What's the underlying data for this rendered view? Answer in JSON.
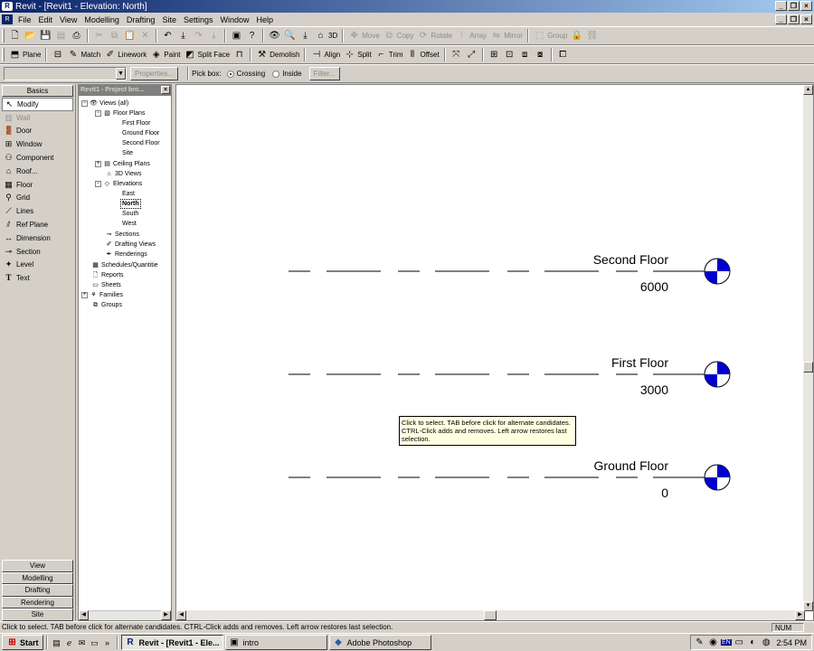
{
  "window": {
    "title": "Revit - [Revit1 - Elevation: North]",
    "app_icon": "revit-logo-icon"
  },
  "menu": [
    "File",
    "Edit",
    "View",
    "Modelling",
    "Drafting",
    "Site",
    "Settings",
    "Window",
    "Help"
  ],
  "toolbar1": {
    "edit_tools": [
      "Move",
      "Copy",
      "Rotate",
      "Array",
      "Mirror",
      "Group"
    ],
    "view_3d_label": "3D"
  },
  "toolbar2": [
    "Plane",
    "Match",
    "Linework",
    "Paint",
    "Split Face",
    "Demolish",
    "Align",
    "Split",
    "Trim",
    "Offset"
  ],
  "options_bar": {
    "properties_label": "Properties...",
    "pick_box_label": "Pick box:",
    "crossing_label": "Crossing",
    "inside_label": "Inside",
    "filter_label": "Filter...",
    "selected": "Crossing"
  },
  "design_bar": {
    "active_tab": "Basics",
    "tools": [
      "Modify",
      "Wall",
      "Door",
      "Window",
      "Component",
      "Roof...",
      "Floor",
      "Grid",
      "Lines",
      "Ref Plane",
      "Dimension",
      "Section",
      "Level",
      "Text"
    ],
    "active_tool": "Modify",
    "disabled_tool": "Wall",
    "bottom_tabs": [
      "View",
      "Modelling",
      "Drafting",
      "Rendering",
      "Site"
    ]
  },
  "project_browser": {
    "title": "Revit1 - Project bro...",
    "root": "Views (all)",
    "floor_plans": "Floor Plans",
    "floor_plan_items": [
      "First Floor",
      "Ground Floor",
      "Second Floor",
      "Site"
    ],
    "ceiling_plans": "Ceiling Plans",
    "views_3d": "3D Views",
    "elevations": "Elevations",
    "elevation_items": [
      "East",
      "North",
      "South",
      "West"
    ],
    "selected_view": "North",
    "sections": "Sections",
    "drafting_views": "Drafting Views",
    "renderings": "Renderings",
    "schedules": "Schedules/Quantitie",
    "reports": "Reports",
    "sheets": "Sheets",
    "families": "Families",
    "groups": "Groups"
  },
  "levels": [
    {
      "name": "Second Floor",
      "elevation": "6000"
    },
    {
      "name": "First Floor",
      "elevation": "3000"
    },
    {
      "name": "Ground Floor",
      "elevation": "0"
    }
  ],
  "level_head_color": "#0000cc",
  "tooltip": "Click to select. TAB before click for alternate candidates. CTRL-Click adds and removes. Left arrow restores last selection.",
  "status": {
    "message": "Click to select. TAB before click for alternate candidates. CTRL-Click adds and removes. Left arrow restores last selection.",
    "num_lock": "NUM"
  },
  "taskbar": {
    "start_label": "Start",
    "tasks": [
      "Revit - [Revit1 - Ele...",
      "intro",
      "Adobe Photoshop"
    ],
    "active_task": "Revit - [Revit1 - Ele...",
    "language": "EN",
    "clock": "2:54 PM"
  }
}
